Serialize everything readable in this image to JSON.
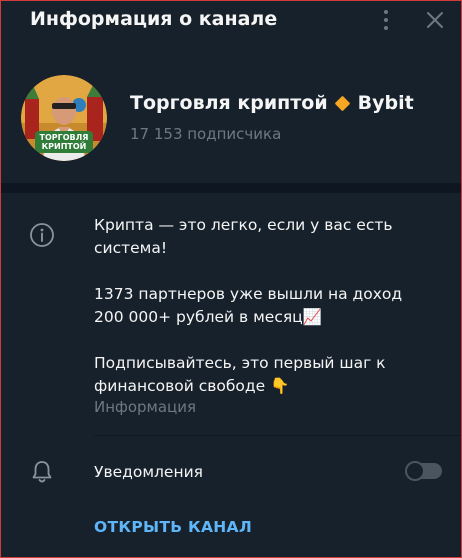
{
  "header": {
    "title": "Информация о канале",
    "menu_icon": "more-vertical-icon",
    "close_icon": "close-icon"
  },
  "channel": {
    "name_part1": "Торговля криптой",
    "name_emoji_icon": "orange-diamond-icon",
    "name_part2": "Bybit",
    "subscribers": "17 153 подписчика",
    "avatar_text_line1": "ТОРГОВЛЯ",
    "avatar_text_line2": "КРИПТОЙ"
  },
  "info": {
    "icon": "info-icon",
    "paragraph1": "Крипта — это легко, если у вас есть система!",
    "paragraph2": "1373 партнеров уже вышли на доход 200 000+ рублей в месяц📈",
    "paragraph3": "Подписывайтесь, это первый шаг к финансовой свободе 👇",
    "label": "Информация"
  },
  "notifications": {
    "icon": "bell-icon",
    "label": "Уведомления",
    "enabled": false
  },
  "actions": {
    "open_channel": "ОТКРЫТЬ КАНАЛ"
  },
  "colors": {
    "background": "#17212b",
    "band": "#0e1621",
    "muted": "#6d7883",
    "accent": "#5eb5f7",
    "diamond": "#f5a623"
  }
}
